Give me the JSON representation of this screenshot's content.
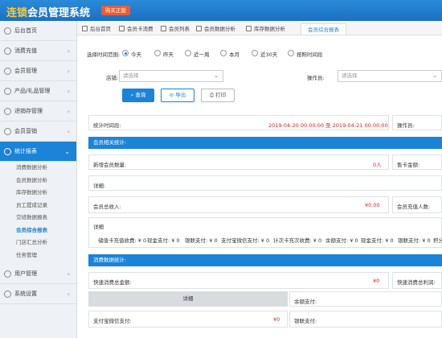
{
  "app": {
    "title_part1": "连锁",
    "title_part2": "会员管理系统",
    "buy_label": "购买正版"
  },
  "sidebar": {
    "items": [
      {
        "label": "后台首页",
        "icon": "home-icon"
      },
      {
        "label": "消费充值",
        "icon": "wallet-icon"
      },
      {
        "label": "会员管理",
        "icon": "user-icon"
      },
      {
        "label": "产品/礼品管理",
        "icon": "gift-icon"
      },
      {
        "label": "进销存管理",
        "icon": "box-icon"
      },
      {
        "label": "会员营销",
        "icon": "megaphone-icon"
      },
      {
        "label": "统计报表",
        "icon": "chart-icon"
      }
    ],
    "subitems": [
      {
        "label": "消费数据分析"
      },
      {
        "label": "会员数据分析"
      },
      {
        "label": "库存数据分析"
      },
      {
        "label": "员工提成记录"
      },
      {
        "label": "交班数据报表"
      },
      {
        "label": "会员综合报表"
      },
      {
        "label": "门店汇总分析"
      },
      {
        "label": "任务管理"
      }
    ],
    "bottom_items": [
      {
        "label": "用户管理",
        "icon": "users-icon"
      },
      {
        "label": "系统设置",
        "icon": "gear-icon"
      }
    ],
    "chevron": "›",
    "active_index": 6,
    "active_sub_index": 5
  },
  "tabs": [
    {
      "label": "后台首页"
    },
    {
      "label": "会员卡消费"
    },
    {
      "label": "会员列表"
    },
    {
      "label": "会员数据分析"
    },
    {
      "label": "库存数据分析"
    },
    {
      "label": "会员综合报表"
    }
  ],
  "filters": {
    "range_label": "选择时间范围:",
    "options": [
      {
        "label": "今天",
        "selected": true
      },
      {
        "label": "昨天",
        "selected": false
      },
      {
        "label": "近一周",
        "selected": false
      },
      {
        "label": "本月",
        "selected": false
      },
      {
        "label": "近30天",
        "selected": false
      },
      {
        "label": "按照时间段",
        "selected": false
      }
    ],
    "store_label": "店铺:",
    "store_placeholder": "请选择",
    "operator_label": "操作员:",
    "operator_placeholder": "请选择",
    "dropdown_arrow": "⌄"
  },
  "buttons": {
    "query": "查询",
    "export": "导出",
    "print": "打印"
  },
  "report": {
    "period_label": "统计时间段:",
    "period_value": "2019-04-20 00:00:00 至 2019-04-21 00:00:00",
    "operator_label": "操作员:",
    "member_section": "会员相关统计:",
    "new_members_label": "新增会员数量:",
    "new_members_value": "0人",
    "card_amount_label": "售卡金额:",
    "detail1_label": "详细:",
    "member_income_label": "会员总收入:",
    "member_income_value": "¥0.00",
    "recharge_people_label": "会员充值人数:",
    "detail2_label": "详细",
    "detail_items": [
      "储值卡充值收费: ¥ 0",
      "现金支付: ¥ 0",
      "银联支付: ¥ 0",
      "支付宝微信支付: ¥ 0",
      "计次卡充次收费: ¥ 0",
      "余额支付: ¥ 0",
      "现金支付: ¥ 0",
      "银联支付: ¥ 0",
      "积分"
    ],
    "consume_section": "消费数据统计:",
    "fast_consume_label": "快速消费总金额:",
    "fast_consume_value": "¥0",
    "fast_profit_label": "快速消费总利润:",
    "detail3_label": "详细",
    "balance_pay_label": "余额支付:",
    "alipay_label": "支付宝微信支付:",
    "alipay_value": "¥0",
    "unionpay_label": "银联支付:"
  }
}
